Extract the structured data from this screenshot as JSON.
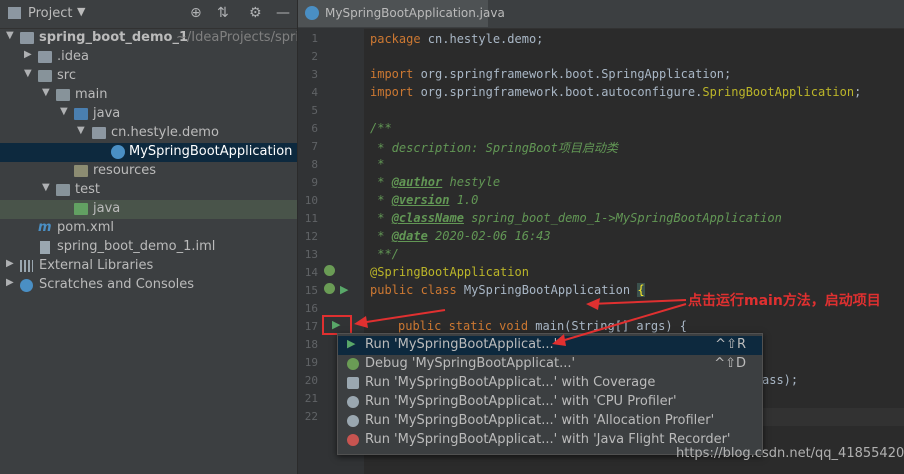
{
  "project_panel": {
    "title": "Project",
    "tree": [
      {
        "label": "spring_boot_demo_1",
        "suffix": "~/IdeaProjects/sprin"
      },
      {
        "label": ".idea"
      },
      {
        "label": "src"
      },
      {
        "label": "main"
      },
      {
        "label": "java"
      },
      {
        "label": "cn.hestyle.demo"
      },
      {
        "label": "MySpringBootApplication"
      },
      {
        "label": "resources"
      },
      {
        "label": "test"
      },
      {
        "label": "java"
      },
      {
        "label": "pom.xml"
      },
      {
        "label": "spring_boot_demo_1.iml"
      },
      {
        "label": "External Libraries"
      },
      {
        "label": "Scratches and Consoles"
      }
    ]
  },
  "editor": {
    "tab_label": "MySpringBootApplication.java",
    "line_numbers": [
      "1",
      "2",
      "3",
      "4",
      "5",
      "6",
      "7",
      "8",
      "9",
      "10",
      "11",
      "12",
      "13",
      "14",
      "15",
      "16",
      "17",
      "18",
      "19",
      "20",
      "21",
      "22"
    ],
    "code": {
      "l1_kw": "package",
      "l1_rest": " cn.hestyle.demo;",
      "l3_kw": "import",
      "l3_rest": " org.springframework.boot.SpringApplication;",
      "l4_kw": "import",
      "l4_rest": " org.springframework.boot.autoconfigure.",
      "l4_ann": "SpringBootApplication",
      "l4_end": ";",
      "l6": "/**",
      "l7": " * description: SpringBoot项目启动类",
      "l8": " *",
      "l9_star": " * ",
      "l9_tag": "@author",
      "l9_val": " hestyle",
      "l10_star": " * ",
      "l10_tag": "@version",
      "l10_val": " 1.0",
      "l11_star": " * ",
      "l11_tag": "@className",
      "l11_val": " spring_boot_demo_1->MySpringBootApplication",
      "l12_star": " * ",
      "l12_tag": "@date",
      "l12_val": " 2020-02-06 16:43",
      "l13": " **/",
      "l14": "@SpringBootApplication",
      "l15_kw": "public class",
      "l15_rest": " MySpringBootApplication ",
      "l15_brace": "{",
      "l17_kw": "public static void",
      "l17_rest": " main(String[] args) {",
      "l20_tail": "ass);"
    }
  },
  "run_menu": {
    "items": [
      {
        "label": "Run 'MySpringBootApplicat...'",
        "shortcut": "^⇧R"
      },
      {
        "label": "Debug 'MySpringBootApplicat...'",
        "shortcut": "^⇧D"
      },
      {
        "label": "Run 'MySpringBootApplicat...' with Coverage"
      },
      {
        "label": "Run 'MySpringBootApplicat...' with 'CPU Profiler'"
      },
      {
        "label": "Run 'MySpringBootApplicat...' with 'Allocation Profiler'"
      },
      {
        "label": "Run 'MySpringBootApplicat...' with 'Java Flight Recorder'"
      }
    ]
  },
  "annotation": {
    "callout": "点击运行main方法，启动项目",
    "watermark": "https://blog.csdn.net/qq_41855420"
  },
  "colors": {
    "accent_red": "#e03030",
    "run_green": "#59a869"
  }
}
